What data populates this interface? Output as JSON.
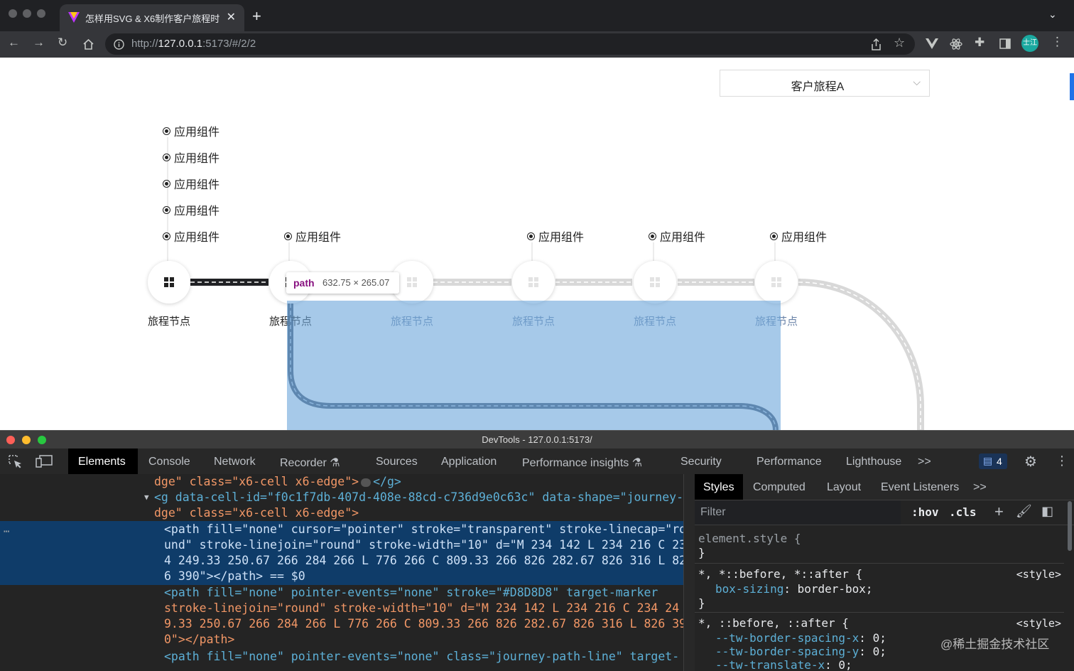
{
  "browser": {
    "tab_title": "怎样用SVG & X6制作客户旅程时",
    "tab_close": "✕",
    "new_tab": "+",
    "tab_menu": "⌄",
    "url_scheme": "http://",
    "url_host": "127.0.0.1",
    "url_rest": ":5173/#/2/2",
    "avatar_text": "士江",
    "icons": [
      "back-icon",
      "forward-icon",
      "reload-icon",
      "home-icon",
      "info-icon",
      "share-icon",
      "bookmark-star-icon",
      "vue-devtools-icon",
      "react-devtools-icon",
      "extensions-icon",
      "side-panel-icon",
      "more-icon"
    ]
  },
  "page": {
    "journey_select": "客户旅程A",
    "component_label": "应用组件",
    "node_label": "旅程节点",
    "tooltip_tag": "path",
    "tooltip_size": "632.75 × 265.07",
    "colors": {
      "track_active": "#202124",
      "track_inactive": "#D8D8D8",
      "highlight": "#6fa8dc"
    }
  },
  "devtools": {
    "window_title": "DevTools - 127.0.0.1:5173/",
    "tabs": [
      "Elements",
      "Console",
      "Network",
      "Recorder",
      "Sources",
      "Application",
      "Performance insights",
      "Security",
      "Performance",
      "Lighthouse"
    ],
    "more_tabs": ">>",
    "issues_count": "4",
    "elements_lines": {
      "l1a": "dge\" class=\"x6-cell x6-edge\">",
      "l1b": "</g>",
      "l2a": "<g data-cell-id=\"f0c1f7db-407d-408e-88cd-c736d9e0c63c\" data-shape=\"journey-e",
      "l2b": "dge\" class=\"x6-cell x6-edge\">",
      "s1": "<path fill=\"none\" cursor=\"pointer\" stroke=\"transparent\" stroke-linecap=\"ro",
      "s2": "und\" stroke-linejoin=\"round\" stroke-width=\"10\" d=\"M 234 142 L 234 216 C 23",
      "s3": "4 249.33 250.67 266 284 266 L 776 266 C 809.33 266 826 282.67 826 316 L 82",
      "s4": "6 390\"></path> == $0",
      "p1": "<path fill=\"none\" pointer-events=\"none\" stroke=\"#D8D8D8\" target-marker",
      "p2": "stroke-linejoin=\"round\" stroke-width=\"10\" d=\"M 234 142 L 234 216 C 234 24",
      "p3": "9.33 250.67 266 284 266 L 776 266 C 809.33 266 826 282.67 826 316 L 826 39",
      "p4": "0\"></path>",
      "q1": "<path fill=\"none\" pointer-events=\"none\" class=\"journey-path-line\" target-"
    },
    "styles_tabs": [
      "Styles",
      "Computed",
      "Layout",
      "Event Listeners"
    ],
    "styles_more": ">>",
    "filter_placeholder": "Filter",
    "hov": ":hov",
    "cls": ".cls",
    "rules": {
      "element_style": "element.style {",
      "close": "}",
      "r1_selector": "*, *::before, *::after {",
      "r1_prop": "box-sizing",
      "r1_val": "border-box;",
      "r2_selector": "*, ::before, ::after {",
      "r2_p1": "--tw-border-spacing-x",
      "r2_p2": "--tw-border-spacing-y",
      "r2_p3": "--tw-translate-x",
      "r2_val": "0;",
      "source": "<style>"
    }
  },
  "watermark": "@稀土掘金技术社区"
}
